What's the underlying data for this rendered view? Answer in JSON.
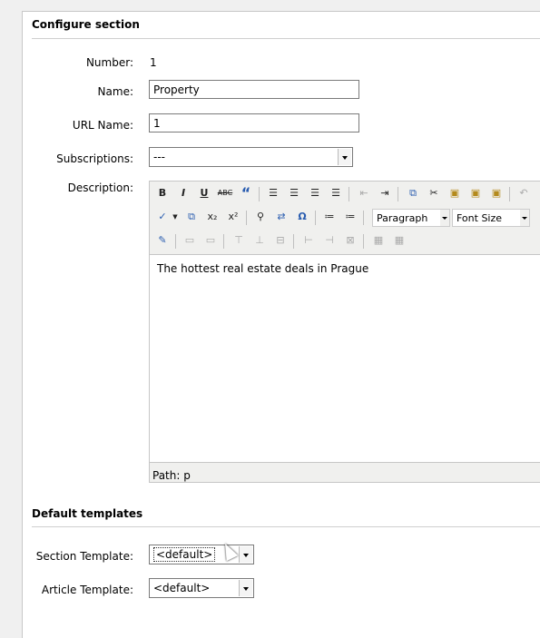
{
  "configure_section": {
    "title": "Configure section",
    "number_label": "Number:",
    "number_value": "1",
    "name_label": "Name:",
    "name_value": "Property",
    "url_name_label": "URL Name:",
    "url_name_value": "1",
    "subscriptions_label": "Subscriptions:",
    "subscriptions_value": "---",
    "description_label": "Description:"
  },
  "editor": {
    "toolbar_row1": [
      "B",
      "I",
      "U",
      "ABC",
      "“"
    ],
    "paragraph_select": "Paragraph",
    "font_size_select": "Font Size",
    "content": "The hottest real estate deals in Prague",
    "path": "Path: p"
  },
  "default_templates": {
    "title": "Default templates",
    "section_template_label": "Section Template:",
    "section_template_value": "<default>",
    "article_template_label": "Article Template:",
    "article_template_value": "<default>"
  }
}
